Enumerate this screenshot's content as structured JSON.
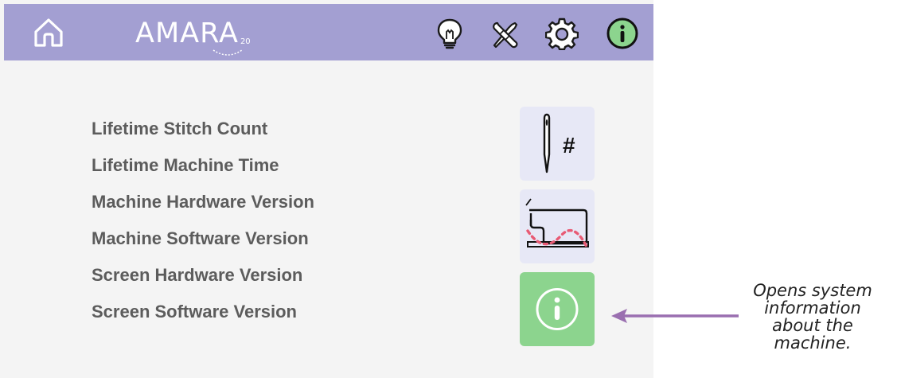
{
  "header": {
    "logo_text": "AMARA",
    "logo_subscript": "20",
    "icons": [
      "home-icon",
      "lightbulb-icon",
      "tools-icon",
      "gear-icon",
      "info-icon"
    ],
    "bar_color": "#a39fd2",
    "active_icon_color": "#8cd48e"
  },
  "info_items": [
    "Lifetime Stitch Count",
    "Lifetime Machine Time",
    "Machine Hardware Version",
    "Machine Software Version",
    "Screen Hardware Version",
    "Screen Software Version"
  ],
  "tiles": [
    {
      "icon": "needle-stitch-count-icon",
      "color": "#e7e8f6"
    },
    {
      "icon": "sewing-machine-icon",
      "color": "#e7e8f6"
    },
    {
      "icon": "info-icon",
      "color": "#8cd48e"
    }
  ],
  "callout": {
    "text": "Opens system information about the machine.",
    "arrow_color": "#9a6fb0"
  }
}
